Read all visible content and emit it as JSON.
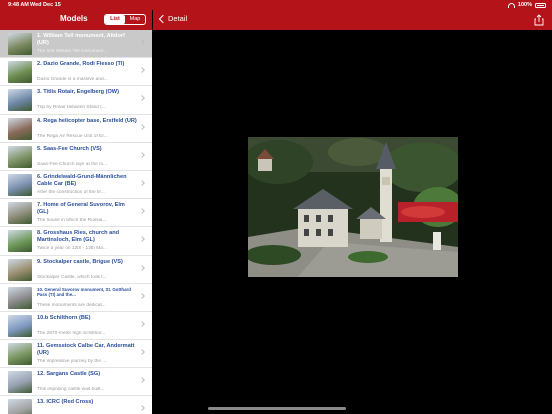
{
  "status": {
    "time": "9:48 AM",
    "date": "Wed Dec 15",
    "battery": "100%"
  },
  "sidebar": {
    "title": "Models",
    "segments": [
      {
        "label": "List",
        "active": true
      },
      {
        "label": "Map",
        "active": false
      }
    ],
    "items": [
      {
        "title": "1. William Tell monument, Altdorf (UR)",
        "subtitle": "The first William Tell monument...",
        "color": "#7d8a62"
      },
      {
        "title": "2. Dazio Grande, Rodi Fiesso (TI)",
        "subtitle": "Dazio Grande is a massive and...",
        "color": "#6f8f52"
      },
      {
        "title": "3. Titlis Rotair, Engelberg (OW)",
        "subtitle": "Trip by Rotair between Stand (...",
        "color": "#6d86a6"
      },
      {
        "title": "4. Rega helicopter base, Erstfeld (UR)",
        "subtitle": "The Rega Air Rescue Unit of Er...",
        "color": "#8a6a5a"
      },
      {
        "title": "5. Saas-Fee Church (VS)",
        "subtitle": "Saas-Fee Church lays at the fo...",
        "color": "#7f9467"
      },
      {
        "title": "6. Grindelwald-Grund-Männlichen Cable Car (BE)",
        "subtitle": "After the construction of the fir...",
        "color": "#7a8fae"
      },
      {
        "title": "7. Home of General Suvorov, Elm (GL)",
        "subtitle": "The house in which the Russia...",
        "color": "#8d8d7a"
      },
      {
        "title": "8. Grosshaus Ries, church and Martinsloch, Elm  (GL)",
        "subtitle": "Twice a year on 12th - 13th Ma...",
        "color": "#6f9a5b"
      },
      {
        "title": "9. Stockalper castle, Brigue (VS)",
        "subtitle": "Stockalper Castle, which took t...",
        "color": "#9a8f6f"
      },
      {
        "title": "10. General Suvorov monument, St. Gotthard Pass (TI) and the...",
        "subtitle": "These monuments are dedicat...",
        "color": "#8a8a8a",
        "small": true
      },
      {
        "title": "10.b Schilthorn (BE)",
        "subtitle": "The 2970-meter high Schilthor...",
        "color": "#7f98c0"
      },
      {
        "title": "11.  Gemsstock Calbe Car, Andermatt (UR)",
        "subtitle": "The impressive journey by the ...",
        "color": "#7b9661"
      },
      {
        "title": "12. Sargans Castle (SG)",
        "subtitle": "This imposing castle was built...",
        "color": "#96a0b0"
      },
      {
        "title": "13. ICRC (Red Cross)",
        "subtitle": "",
        "color": "#a0a0a0"
      }
    ]
  },
  "detail": {
    "back_label": "Detail"
  }
}
